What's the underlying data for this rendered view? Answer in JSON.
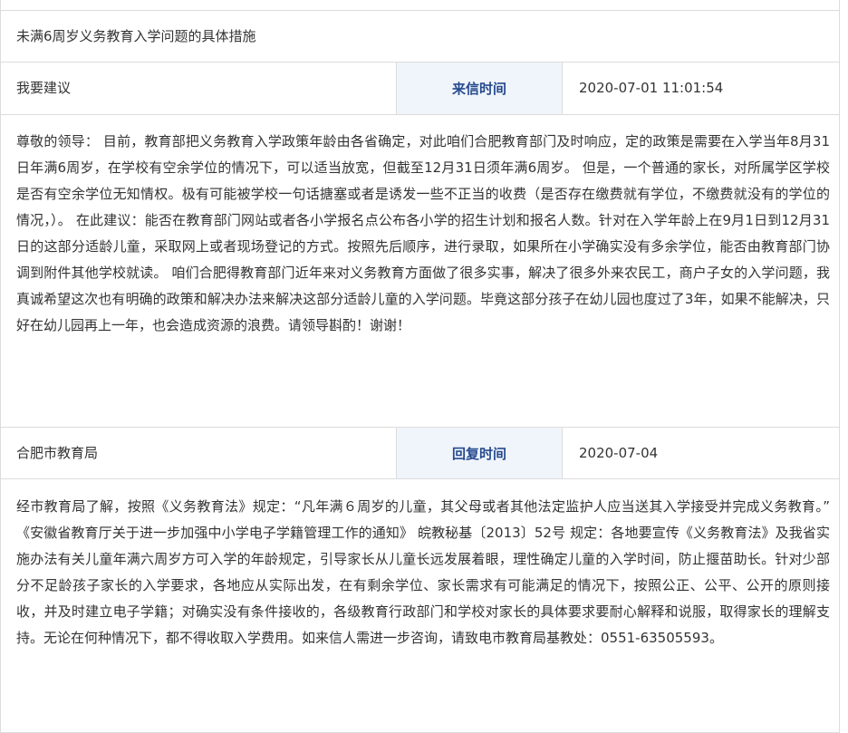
{
  "title": "未满6周岁义务教育入学问题的具体措施",
  "letter": {
    "author": "我要建议",
    "time_label": "来信时间",
    "time_value": "2020-07-01 11:01:54",
    "content": "尊敬的领导： 目前，教育部把义务教育入学政策年龄由各省确定，对此咱们合肥教育部门及时响应，定的政策是需要在入学当年8月31日年满6周岁，在学校有空余学位的情况下，可以适当放宽，但截至12月31日须年满6周岁。 但是，一个普通的家长，对所属学区学校是否有空余学位无知情权。极有可能被学校一句话搪塞或者是诱发一些不正当的收费（是否存在缴费就有学位，不缴费就没有的学位的情况，）。 在此建议：能否在教育部门网站或者各小学报名点公布各小学的招生计划和报名人数。针对在入学年龄上在9月1日到12月31日的这部分适龄儿童，采取网上或者现场登记的方式。按照先后顺序，进行录取，如果所在小学确实没有多余学位，能否由教育部门协调到附件其他学校就读。 咱们合肥得教育部门近年来对义务教育方面做了很多实事，解决了很多外来农民工，商户子女的入学问题，我真诚希望这次也有明确的政策和解决办法来解决这部分适龄儿童的入学问题。毕竟这部分孩子在幼儿园也度过了3年，如果不能解决，只好在幼儿园再上一年，也会造成资源的浪费。请领导斟酌！谢谢！"
  },
  "reply": {
    "author": "合肥市教育局",
    "time_label": "回复时间",
    "time_value": "2020-07-04",
    "content": "经市教育局了解，按照《义务教育法》规定：“凡年满６周岁的儿童，其父母或者其他法定监护人应当送其入学接受并完成义务教育。” 《安徽省教育厅关于进一步加强中小学电子学籍管理工作的通知》 皖教秘基〔2013〕52号 规定：各地要宣传《义务教育法》及我省实施办法有关儿童年满六周岁方可入学的年龄规定，引导家长从儿童长远发展着眼，理性确定儿童的入学时间，防止揠苗助长。针对少部分不足龄孩子家长的入学要求，各地应从实际出发，在有剩余学位、家长需求有可能满足的情况下，按照公正、公平、公开的原则接收，并及时建立电子学籍；对确实没有条件接收的，各级教育行政部门和学校对家长的具体要求要耐心解释和说服，取得家长的理解支持。无论在何种情况下，都不得收取入学费用。如来信人需进一步咨询，请致电市教育局基教处：0551-63505593。"
  },
  "colors": {
    "label_text": "#264b8e",
    "label_background": "#f0f4fb",
    "border": "#dcdcdc",
    "body_text": "#333333"
  }
}
